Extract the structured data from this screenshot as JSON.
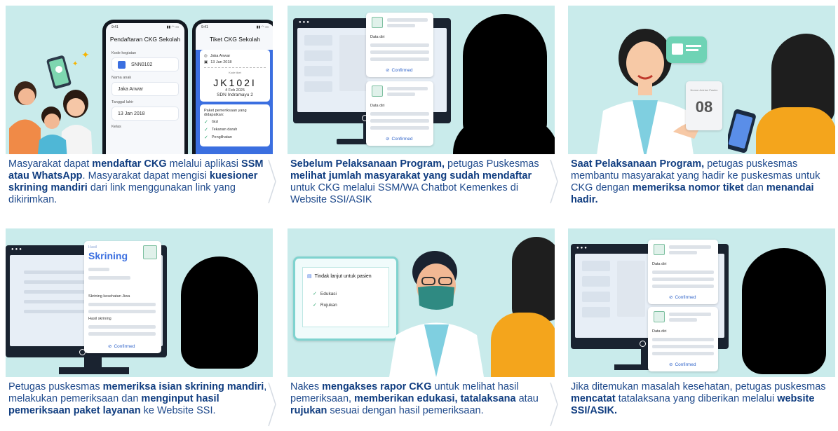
{
  "panels": [
    {
      "caption_parts": [
        {
          "t": "Masyarakat dapat ",
          "b": false
        },
        {
          "t": "mendaftar CKG",
          "b": true
        },
        {
          "t": " melalui aplikasi ",
          "b": false
        },
        {
          "t": "SSM atau WhatsApp",
          "b": true
        },
        {
          "t": ". Masyarakat dapat mengisi ",
          "b": false
        },
        {
          "t": "kuesioner skrining mandiri",
          "b": true
        },
        {
          "t": " dari link menggunakan link yang dikirimkan.",
          "b": false
        }
      ]
    },
    {
      "caption_parts": [
        {
          "t": "Sebelum Pelaksanaan Program,",
          "b": true
        },
        {
          "t": " petugas Puskesmas ",
          "b": false
        },
        {
          "t": "melihat jumlah masyarakat yang sudah mendaftar",
          "b": true
        },
        {
          "t": " untuk CKG melalui SSM/WA Chatbot Kemenkes di Website SSI/ASIK",
          "b": false
        }
      ]
    },
    {
      "caption_parts": [
        {
          "t": "Saat Pelaksanaan Program,",
          "b": true
        },
        {
          "t": " petugas puskesmas membantu masyarakat  yang hadir ke puskesmas untuk CKG dengan ",
          "b": false
        },
        {
          "t": "memeriksa nomor tiket",
          "b": true
        },
        {
          "t": " dan ",
          "b": false
        },
        {
          "t": "menandai hadir.",
          "b": true
        }
      ]
    },
    {
      "caption_parts": [
        {
          "t": "Petugas puskesmas ",
          "b": false
        },
        {
          "t": "memeriksa isian skrining mandiri",
          "b": true
        },
        {
          "t": ", melakukan pemeriksaan dan ",
          "b": false
        },
        {
          "t": "menginput hasil pemeriksaan paket layanan",
          "b": true
        },
        {
          "t": " ke Website SSI.",
          "b": false
        }
      ]
    },
    {
      "caption_parts": [
        {
          "t": "Nakes ",
          "b": false
        },
        {
          "t": "mengakses rapor CKG",
          "b": true
        },
        {
          "t": " untuk melihat hasil pemeriksaan, ",
          "b": false
        },
        {
          "t": "memberikan edukasi, tatalaksana",
          "b": true
        },
        {
          "t": " atau ",
          "b": false
        },
        {
          "t": "rujukan",
          "b": true
        },
        {
          "t": " sesuai dengan hasil pemeriksaan.",
          "b": false
        }
      ]
    },
    {
      "caption_parts": [
        {
          "t": "Jika ditemukan masalah kesehatan, petugas puskesmas ",
          "b": false
        },
        {
          "t": "mencatat",
          "b": true
        },
        {
          "t": " tatalaksana yang diberikan melalui ",
          "b": false
        },
        {
          "t": "website SSI/ASIK.",
          "b": true
        }
      ]
    }
  ],
  "phone1": {
    "status_time": "9:41",
    "title": "Pendaftaran CKG Sekolah",
    "kode_label": "Kode kegiatan",
    "kode_value": "SNN0102",
    "nama_label": "Nama anak",
    "nama_value": "Jaka Anwar",
    "tgl_label": "Tanggal lahir",
    "tgl_value": "13 Jan 2018",
    "kelas_label": "Kelas"
  },
  "phone2": {
    "status_time": "9:41",
    "title": "Tiket CKG Sekolah",
    "name": "Jaka Anwar",
    "dob": "13 Jan 2018",
    "kode_label": "Kode tiket",
    "code": "JK102I",
    "date": "4 Feb 2025",
    "school": "SDN Indramayu 2",
    "paket_label": "Paket pemeriksaan yang didapatkan:",
    "items": [
      "Gizi",
      "Tekanan darah",
      "Penglihatan"
    ]
  },
  "panel2": {
    "data_diri": "Data diri",
    "confirmed": "Confirmed"
  },
  "panel3": {
    "antrian_label": "Nomor Antrian Pasien",
    "antrian_number": "08"
  },
  "panel4": {
    "hasil_label": "Hasil",
    "title": "Skrining",
    "jiwa_label": "Skrining kesehatan Jiwa",
    "hasil_skrining": "Hasil skrining",
    "confirmed": "Confirmed"
  },
  "panel5": {
    "title": "Tindak lanjut untuk pasien",
    "items": [
      "Edukasi",
      "Rujukan"
    ]
  },
  "panel6": {
    "data_diri": "Data diri",
    "confirmed": "Confirmed"
  },
  "colors": {
    "scene_bg": "#c9ebeb",
    "caption_text": "#1f4a8c",
    "accent_blue": "#3b6fe0",
    "confirm_blue": "#2f63c9",
    "check_green": "#27a36b"
  }
}
